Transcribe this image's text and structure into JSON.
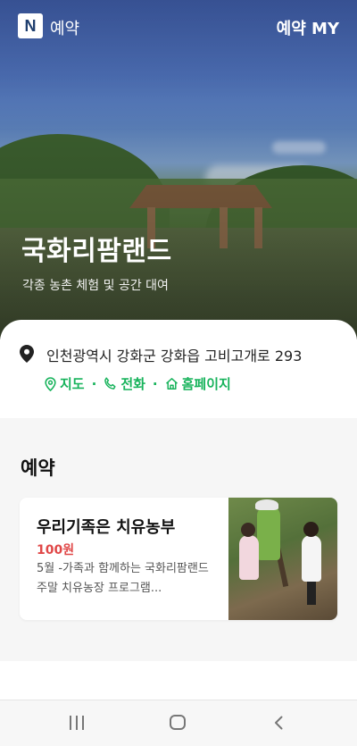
{
  "header": {
    "logo_letter": "N",
    "brand": "예약",
    "my_link": "예약 MY"
  },
  "place": {
    "name": "국화리팜랜드",
    "subtitle": "각종 농촌 체험 및 공간 대여",
    "address": "인천광역시 강화군 강화읍 고비고개로 293",
    "links": {
      "map": "지도",
      "phone": "전화",
      "homepage": "홈페이지"
    }
  },
  "reservation": {
    "section_title": "예약",
    "items": [
      {
        "title": "우리기족은 치유농부",
        "price": "100원",
        "description": "5월 -가족과 함께하는 국화리팜랜드 주말 치유농장 프로그램..."
      }
    ]
  },
  "colors": {
    "accent_green": "#18b35c",
    "price_red": "#e04848"
  },
  "icons": [
    "map-pin-icon",
    "location-icon",
    "phone-icon",
    "home-icon",
    "recents-icon",
    "home-nav-icon",
    "back-icon"
  ]
}
